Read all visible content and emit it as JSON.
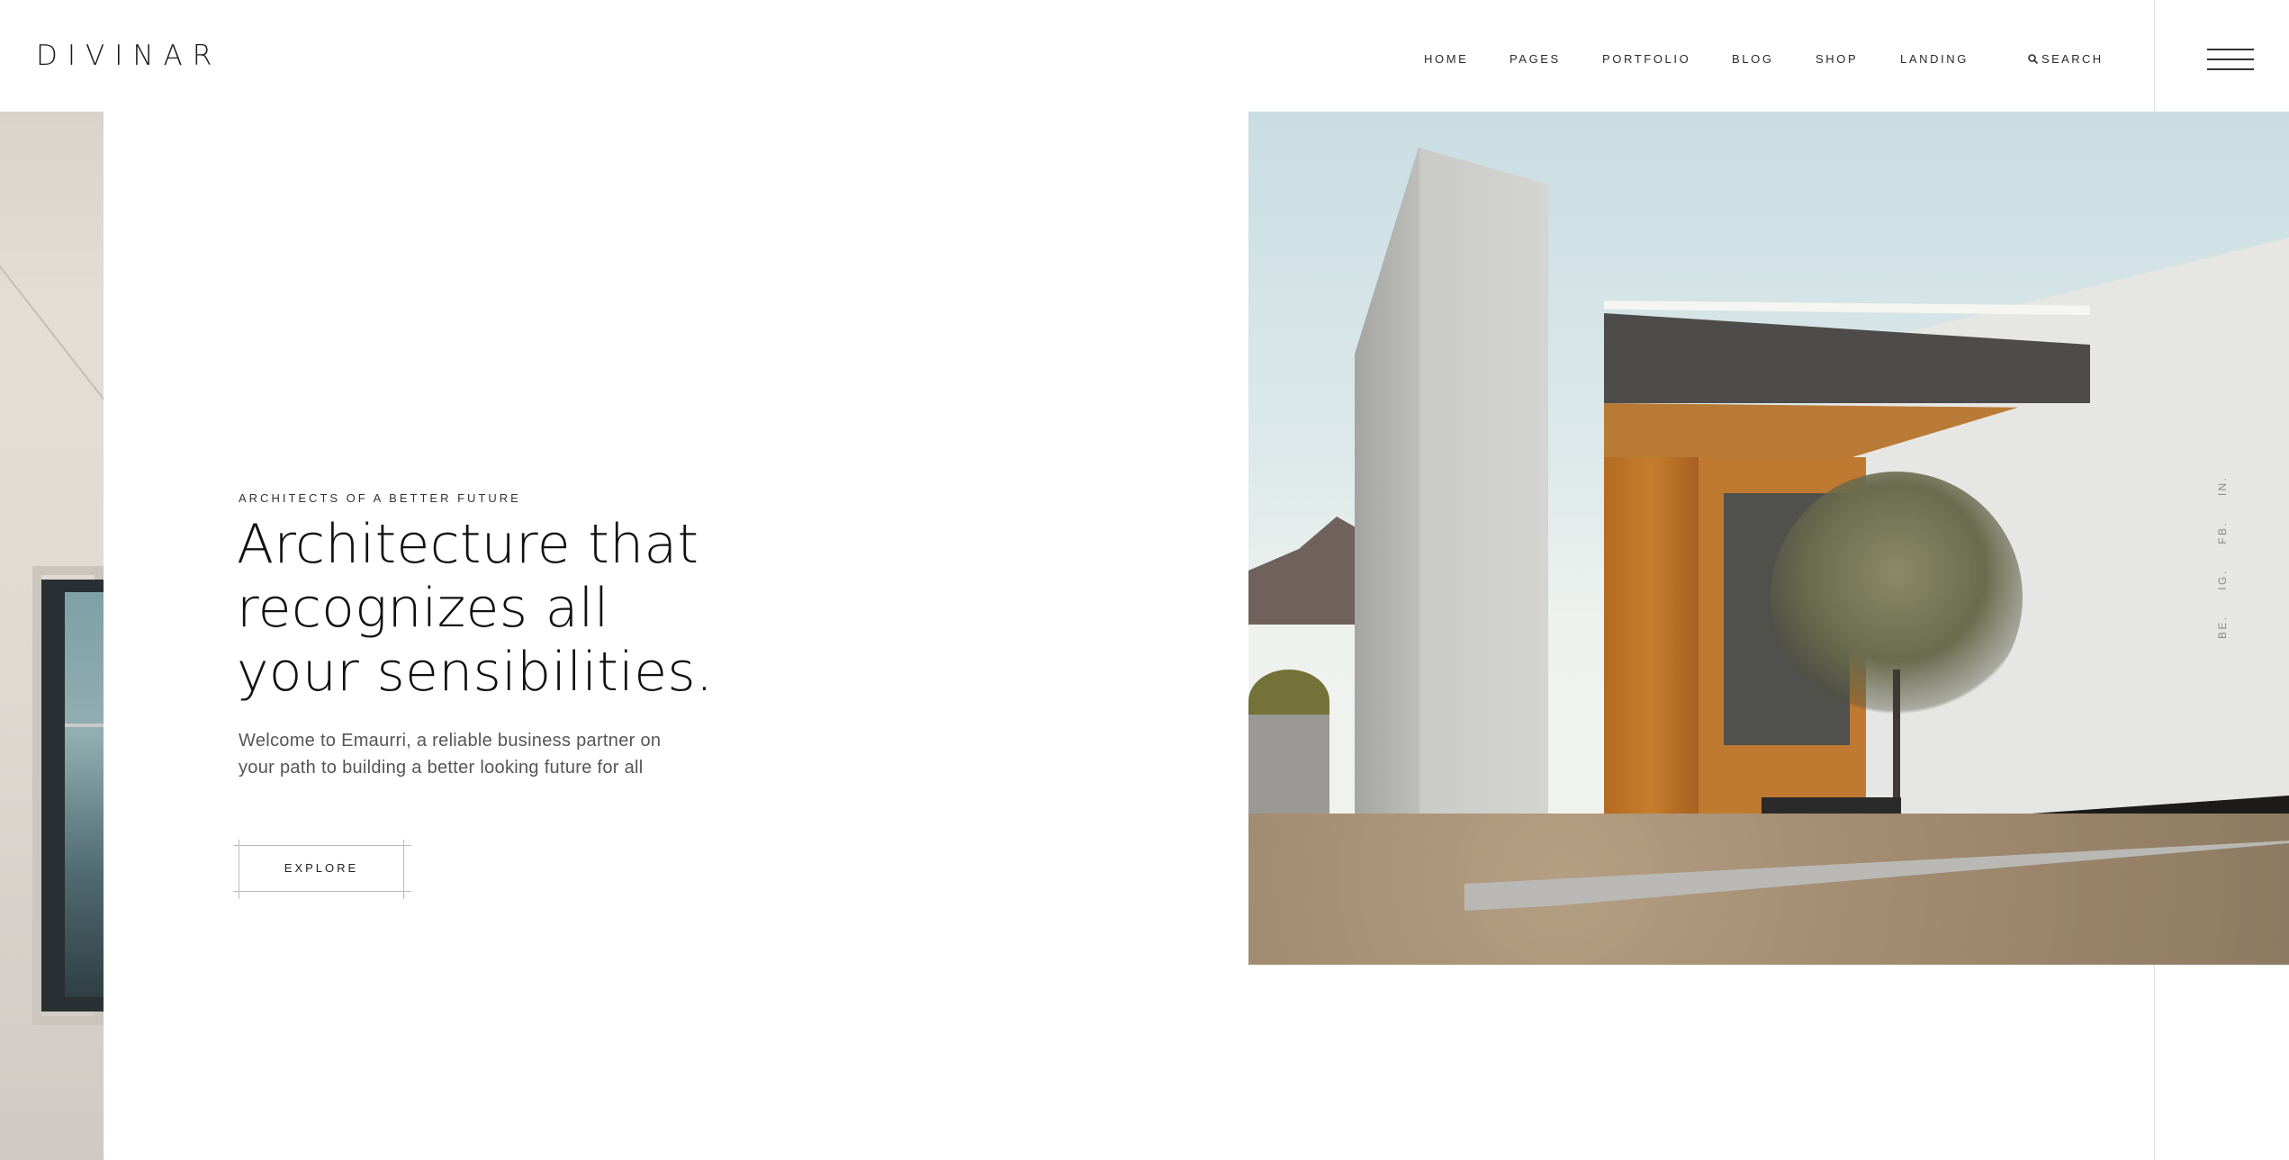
{
  "brand": {
    "logo": "DIVINAR"
  },
  "nav": {
    "items": [
      {
        "label": "HOME"
      },
      {
        "label": "PAGES"
      },
      {
        "label": "PORTFOLIO"
      },
      {
        "label": "BLOG"
      },
      {
        "label": "SHOP"
      },
      {
        "label": "LANDING"
      }
    ],
    "search_label": "SEARCH",
    "search_icon": "search-icon",
    "menu_icon": "hamburger-menu-icon"
  },
  "hero": {
    "eyebrow": "ARCHITECTS OF A BETTER FUTURE",
    "headline": "Architecture that recognizes all your sensibilities.",
    "intro": "Welcome to Emaurri, a reliable business partner on your path to building a better looking future for all",
    "cta_label": "EXPLORE"
  },
  "social": {
    "items": [
      {
        "label": "BE."
      },
      {
        "label": "IG."
      },
      {
        "label": "FB."
      },
      {
        "label": "IN."
      }
    ]
  },
  "colors": {
    "background": "#ffffff",
    "text": "#111111",
    "muted": "#555555",
    "divider": "#e3e3e3"
  }
}
